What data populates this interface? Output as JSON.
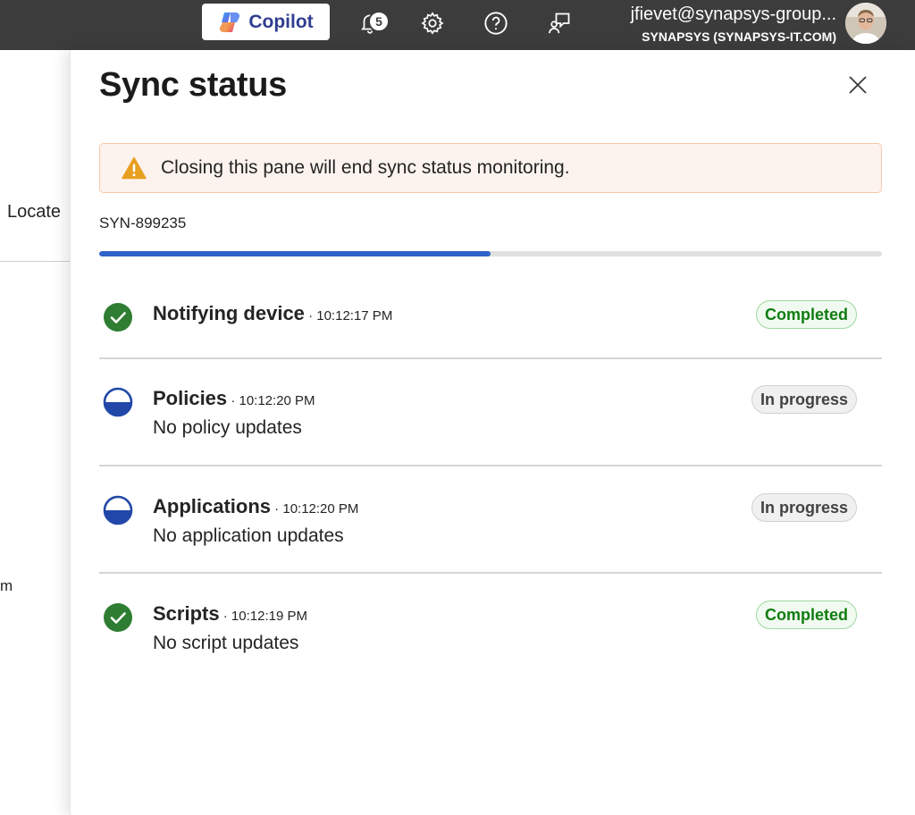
{
  "topbar": {
    "copilot_label": "Copilot",
    "notification_count": "5",
    "account_email": "jfievet@synapsys-group...",
    "account_tenant": "SYNAPSYS (SYNAPSYS-IT.COM)",
    "icons": [
      "copilot-icon",
      "bell-icon",
      "gear-icon",
      "help-icon",
      "feedback-icon",
      "avatar"
    ]
  },
  "background": {
    "locate_label": "Locate",
    "fragment_label": "m"
  },
  "pane": {
    "title": "Sync status",
    "warning": "Closing this pane will end sync status monitoring.",
    "device_id": "SYN-899235",
    "progress_fraction": 0.5,
    "steps": [
      {
        "name": "Notifying device",
        "time": " · 10:12:17 PM",
        "sub": "",
        "status": "Completed",
        "state": "completed"
      },
      {
        "name": "Policies",
        "time": " · 10:12:20 PM",
        "sub": "No policy updates",
        "status": "In progress",
        "state": "in-progress"
      },
      {
        "name": "Applications",
        "time": " · 10:12:20 PM",
        "sub": "No application updates",
        "status": "In progress",
        "state": "in-progress"
      },
      {
        "name": "Scripts",
        "time": " · 10:12:19 PM",
        "sub": "No script updates",
        "status": "Completed",
        "state": "completed"
      }
    ]
  },
  "colors": {
    "topbar": "#3c3c3c",
    "accent_blue": "#2f62c9",
    "success_green": "#107c10",
    "warning_amber": "#e8a020",
    "warning_bg": "#fdf3ee"
  }
}
